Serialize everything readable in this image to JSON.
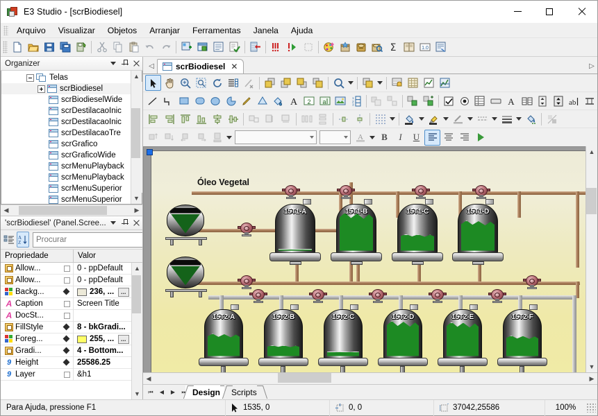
{
  "window": {
    "title": "E3 Studio - [scrBiodiesel]",
    "app_icon": "e3-studio-icon",
    "minimize": "minimize-icon",
    "maximize": "maximize-icon",
    "close": "close-icon"
  },
  "menu": {
    "items": [
      {
        "label": "Arquivo"
      },
      {
        "label": "Visualizar"
      },
      {
        "label": "Objetos"
      },
      {
        "label": "Arranjar"
      },
      {
        "label": "Ferramentas"
      },
      {
        "label": "Janela"
      },
      {
        "label": "Ajuda"
      }
    ]
  },
  "main_toolbar": {
    "buttons": [
      {
        "name": "new-icon"
      },
      {
        "name": "open-folder-icon"
      },
      {
        "name": "save-icon"
      },
      {
        "name": "save-all-icon"
      },
      {
        "name": "save-as-icon"
      },
      {
        "sep": true
      },
      {
        "name": "cut-icon"
      },
      {
        "name": "copy-icon"
      },
      {
        "name": "paste-icon"
      },
      {
        "name": "undo-icon"
      },
      {
        "name": "redo-icon"
      },
      {
        "sep": true
      },
      {
        "name": "insert-object-icon"
      },
      {
        "name": "new-screen-icon"
      },
      {
        "name": "properties-icon"
      },
      {
        "name": "verify-icon"
      },
      {
        "sep": true
      },
      {
        "name": "align-left-edge-icon"
      },
      {
        "sep": true
      },
      {
        "name": "stop-icon"
      },
      {
        "name": "run-icon"
      },
      {
        "name": "pause-icon"
      },
      {
        "sep": true
      },
      {
        "name": "color-palette-icon"
      },
      {
        "name": "library-icon"
      },
      {
        "name": "database-icon"
      },
      {
        "name": "query-icon"
      },
      {
        "name": "sum-icon"
      },
      {
        "name": "book-icon"
      },
      {
        "name": "version-icon"
      },
      {
        "name": "report-icon"
      }
    ]
  },
  "organizer": {
    "title": "Organizer",
    "controls": {
      "dropdown": "chevron-down-icon",
      "pin": "pin-icon",
      "close": "close-icon"
    },
    "root": {
      "label": "Telas",
      "expanded": true
    },
    "items": [
      {
        "label": "scrBiodiesel",
        "expandable": true,
        "selected": true
      },
      {
        "label": "scrBiodieselWide"
      },
      {
        "label": "scrDestilacaoInic"
      },
      {
        "label": "scrDestilacaoInic"
      },
      {
        "label": "scrDestilacaoTre"
      },
      {
        "label": "scrGrafico"
      },
      {
        "label": "scrGraficoWide"
      },
      {
        "label": "scrMenuPlayback"
      },
      {
        "label": "scrMenuPlayback"
      },
      {
        "label": "scrMenuSuperior"
      },
      {
        "label": "scrMenuSuperior"
      }
    ]
  },
  "properties": {
    "title": "'scrBiodiesel' (Panel.Scree...",
    "controls": {
      "dropdown": "chevron-down-icon",
      "pin": "pin-icon",
      "close": "close-icon"
    },
    "toolbar": {
      "categorized": "categorized-view-icon",
      "alphabetic": "alphabetic-sort-icon",
      "search_placeholder": "Procurar",
      "search_value": "",
      "search_icon": "search-icon"
    },
    "columns": [
      "Propriedade",
      "Valor"
    ],
    "rows": [
      {
        "icon": "enum",
        "name": "Allow...",
        "mark": "square",
        "value": "0 - ppDefault",
        "bold": false
      },
      {
        "icon": "enum",
        "name": "Allow...",
        "mark": "square",
        "value": "0 - ppDefault",
        "bold": false
      },
      {
        "icon": "color",
        "name": "Backg...",
        "mark": "diamond",
        "value": "236, ...",
        "bold": true,
        "swatch": "#ece9d8",
        "ellipsis": "..."
      },
      {
        "icon": "text",
        "name": "Caption",
        "mark": "square",
        "value": "Screen Title",
        "bold": false
      },
      {
        "icon": "text",
        "name": "DocSt...",
        "mark": "square",
        "value": "",
        "bold": false
      },
      {
        "icon": "enum",
        "name": "FillStyle",
        "mark": "diamond",
        "value": "8 - bkGradi...",
        "bold": true
      },
      {
        "icon": "color",
        "name": "Foreg...",
        "mark": "diamond",
        "value": "255, ...",
        "bold": true,
        "swatch": "#ffff66",
        "ellipsis": "..."
      },
      {
        "icon": "enum",
        "name": "Gradi...",
        "mark": "diamond",
        "value": "4 - Bottom...",
        "bold": true
      },
      {
        "icon": "number",
        "name": "Height",
        "mark": "diamond",
        "value": "25586.25",
        "bold": true
      },
      {
        "icon": "number",
        "name": "Layer",
        "mark": "square",
        "value": "&h1",
        "bold": false
      }
    ]
  },
  "document": {
    "tab_label": "scrBiodiesel",
    "tab_icon": "screen-icon",
    "tab_close": "close-icon",
    "nav_prev": "nav-prev-icon",
    "nav_next": "nav-next-icon"
  },
  "object_toolbar": {
    "buttons": [
      {
        "name": "select-arrow-icon",
        "active": true
      },
      {
        "name": "pan-hand-icon"
      },
      {
        "name": "zoom-icon"
      },
      {
        "name": "zoom-region-icon"
      },
      {
        "name": "rotate-icon"
      },
      {
        "name": "list-icon"
      },
      {
        "name": "no-link-icon"
      },
      {
        "sep": true
      },
      {
        "name": "bring-to-front-icon"
      },
      {
        "name": "send-to-back-icon"
      },
      {
        "name": "bring-forward-icon"
      },
      {
        "name": "send-backward-icon"
      },
      {
        "sep": true
      },
      {
        "name": "zoom-level-icon",
        "dropdown": true
      },
      {
        "sep": true
      },
      {
        "name": "group-icon",
        "dropdown": true
      },
      {
        "sep": true
      },
      {
        "name": "alarm-icon"
      },
      {
        "name": "grid-data-icon"
      },
      {
        "name": "trend-chart-icon"
      },
      {
        "name": "xy-chart-icon"
      }
    ]
  },
  "draw_toolbar": {
    "buttons": [
      {
        "name": "line-icon"
      },
      {
        "name": "polyline-icon"
      },
      {
        "name": "rectangle-icon"
      },
      {
        "name": "rounded-rectangle-icon"
      },
      {
        "name": "ellipse-icon"
      },
      {
        "name": "arc-icon"
      },
      {
        "name": "pencil-icon"
      },
      {
        "name": "polygon-icon"
      },
      {
        "name": "fill-icon"
      },
      {
        "name": "text-icon"
      },
      {
        "name": "display-icon"
      },
      {
        "name": "setpoint-icon"
      },
      {
        "name": "image-icon"
      },
      {
        "name": "list-box-icon"
      },
      {
        "sep": true
      },
      {
        "name": "align-objects-icon"
      },
      {
        "name": "distribute-icon"
      },
      {
        "sep": true
      },
      {
        "name": "link-icon"
      },
      {
        "name": "add-link-icon"
      },
      {
        "sep": true
      },
      {
        "name": "checkbox-icon"
      },
      {
        "name": "radio-button-icon"
      },
      {
        "name": "grid-icon"
      },
      {
        "name": "button-icon"
      },
      {
        "name": "label-icon"
      },
      {
        "name": "table-icon"
      },
      {
        "name": "spin-icon"
      },
      {
        "name": "updown-icon"
      },
      {
        "name": "textbox-icon"
      },
      {
        "name": "scrollbar-icon"
      }
    ]
  },
  "align_toolbar": {
    "buttons": [
      {
        "name": "align-left-icon"
      },
      {
        "name": "align-right-icon"
      },
      {
        "name": "align-top-icon"
      },
      {
        "name": "align-bottom-icon"
      },
      {
        "name": "align-center-h-icon"
      },
      {
        "name": "align-center-v-icon"
      },
      {
        "sep": true
      },
      {
        "name": "same-size-icon"
      },
      {
        "name": "same-width-icon"
      },
      {
        "name": "same-height-icon"
      },
      {
        "sep": true
      },
      {
        "name": "space-across-icon"
      },
      {
        "name": "space-down-icon"
      },
      {
        "sep": true
      },
      {
        "name": "center-horizontally-icon"
      },
      {
        "name": "center-vertically-icon"
      },
      {
        "sep": true
      },
      {
        "name": "snap-grid-icon",
        "dropdown": true
      },
      {
        "sep": true
      },
      {
        "name": "fill-color-icon",
        "dropdown": true
      },
      {
        "name": "highlight-color-icon",
        "dropdown": true
      },
      {
        "name": "line-color-icon",
        "dropdown": true
      },
      {
        "name": "line-style-icon",
        "dropdown": true
      },
      {
        "name": "line-weight-icon",
        "dropdown": true
      },
      {
        "name": "gradient-fill-icon"
      },
      {
        "sep": true
      },
      {
        "name": "transparency-icon"
      }
    ]
  },
  "format_toolbar": {
    "buttons": [
      {
        "name": "top-align-text-icon"
      },
      {
        "name": "bottom-align-text-icon"
      },
      {
        "name": "left-align-text-icon"
      },
      {
        "name": "right-align-text-icon"
      },
      {
        "name": "text-position-icon",
        "dropdown": true
      }
    ],
    "font_family": "",
    "font_size": "",
    "font_color": "font-color-icon",
    "bold": "B",
    "italic": "I",
    "underline": "U",
    "align_left": "align-text-left-icon",
    "align_center": "align-text-center-icon",
    "align_right": "align-text-right-icon",
    "run_icon": "run-green-icon"
  },
  "canvas": {
    "caption": "Óleo Vegetal",
    "tanks_row1": [
      {
        "label": "15T1-A",
        "level_pct": 4
      },
      {
        "label": "15T1-B",
        "level_pct": 78
      },
      {
        "label": "15T1-C",
        "level_pct": 34
      },
      {
        "label": "15T1-D",
        "level_pct": 62
      }
    ],
    "tanks_row2": [
      {
        "label": "15T2-A",
        "level_pct": 46
      },
      {
        "label": "15T2-B",
        "level_pct": 22
      },
      {
        "label": "15T2-C",
        "level_pct": 10
      },
      {
        "label": "15T2-D",
        "level_pct": 72
      },
      {
        "label": "15T2-E",
        "level_pct": 70
      },
      {
        "label": "15T2-F",
        "level_pct": 42
      }
    ],
    "horizontal_tanks": [
      {
        "name": "oil-tank-upper",
        "level_pct": 55
      },
      {
        "name": "oil-tank-lower",
        "level_pct": 55
      }
    ],
    "selection_handle": "selection-handle"
  },
  "sheet_tabs": {
    "nav": [
      "first-icon",
      "prev-icon",
      "next-icon",
      "last-icon"
    ],
    "tabs": [
      {
        "label": "Design",
        "active": true
      },
      {
        "label": "Scripts",
        "active": false
      }
    ]
  },
  "statusbar": {
    "hint": "Para Ajuda, pressione F1",
    "cursor_icon": "cursor-icon",
    "cursor_pos": "1535, 0",
    "origin_icon": "origin-icon",
    "origin": "0, 0",
    "size_icon": "size-icon",
    "size": "37042,25586",
    "zoom": "100%"
  },
  "colors": {
    "accent": "#1c6fe8",
    "canvas_top": "#edebd8",
    "canvas_bottom": "#f0eba6",
    "pipe": "#a97d58",
    "valve": "#b1646c",
    "level_green": "#1d8a23"
  }
}
